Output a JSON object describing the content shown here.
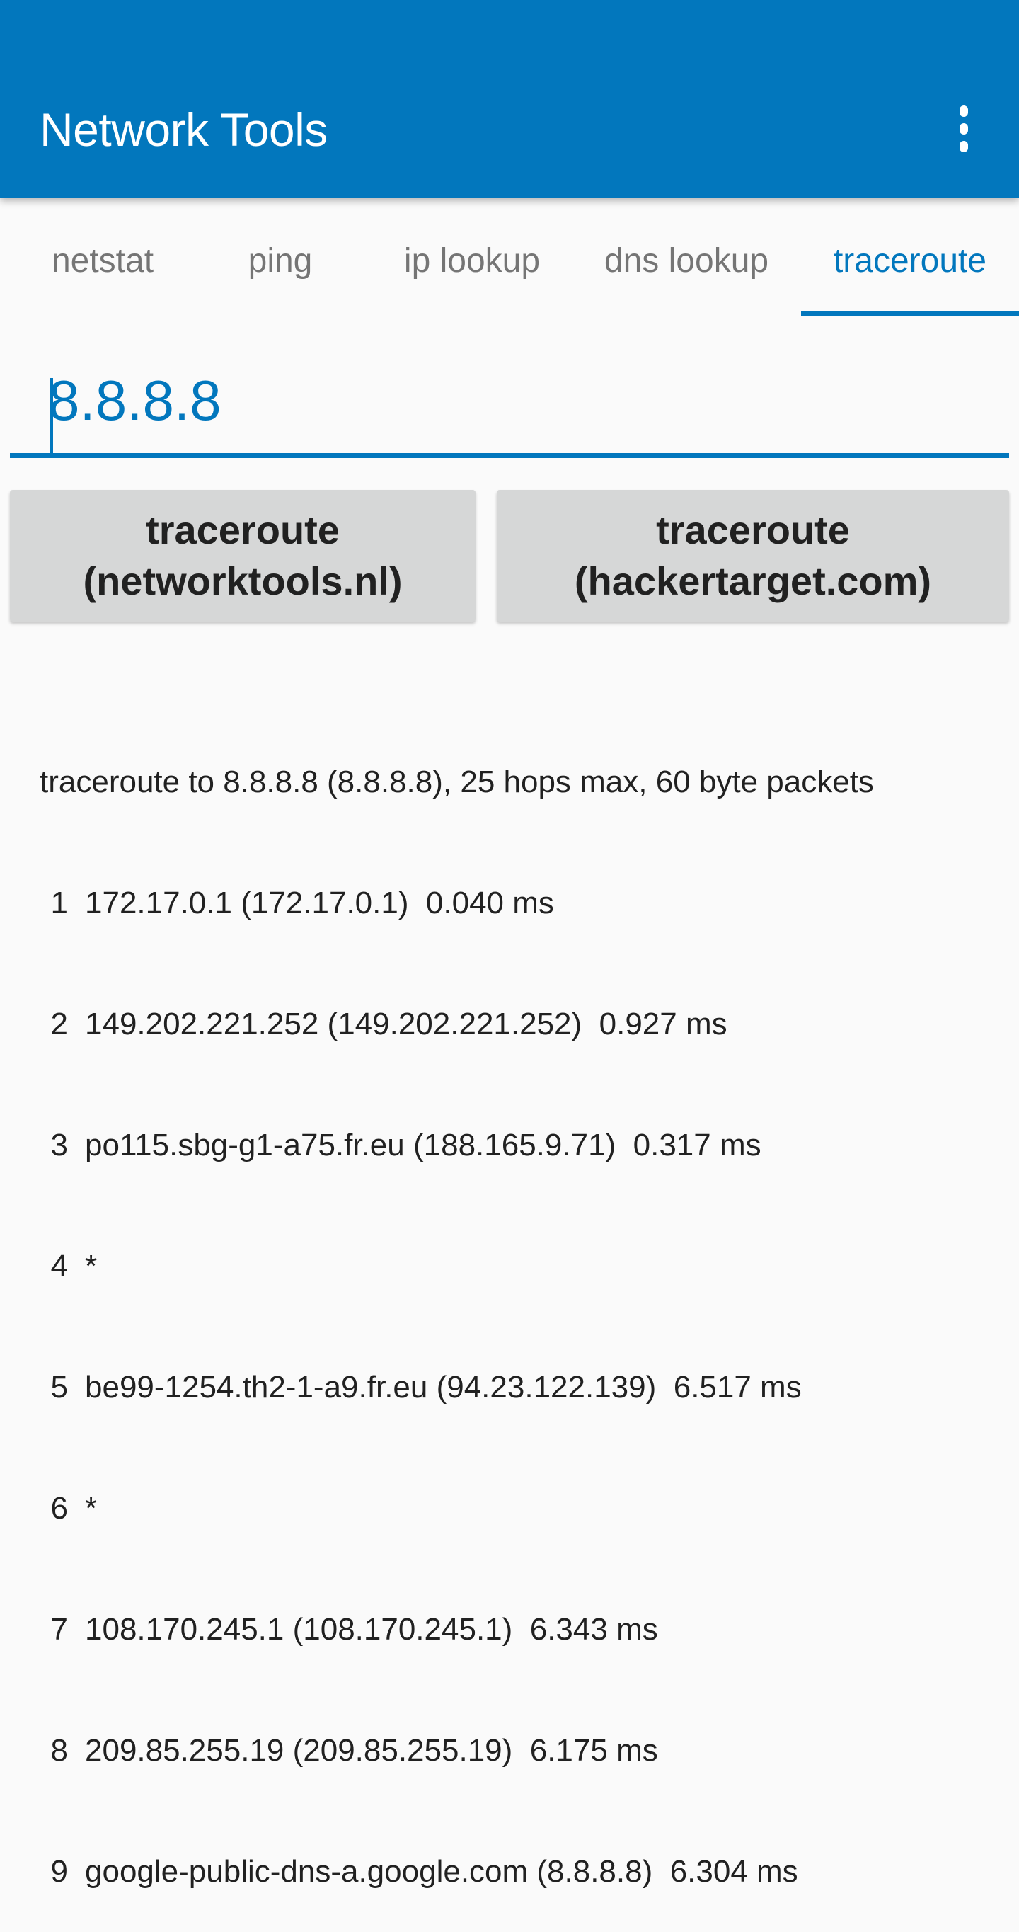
{
  "app_bar": {
    "title": "Network Tools",
    "menu_icon": "more-vert-icon",
    "color": "#0277bd"
  },
  "tabs": [
    {
      "label": "netstat",
      "active": false
    },
    {
      "label": "ping",
      "active": false
    },
    {
      "label": "ip lookup",
      "active": false
    },
    {
      "label": "dns lookup",
      "active": false
    },
    {
      "label": "traceroute",
      "active": true
    }
  ],
  "host_input": {
    "value": "8.8.8.8"
  },
  "buttons": {
    "networktools": {
      "line1": "traceroute",
      "line2": "(networktools.nl)"
    },
    "hackertarget": {
      "line1": "traceroute",
      "line2": "(hackertarget.com)"
    }
  },
  "output": {
    "header": "traceroute to 8.8.8.8 (8.8.8.8), 25 hops max, 60 byte packets",
    "hops": [
      {
        "num": "1",
        "text": "172.17.0.1 (172.17.0.1)  0.040 ms"
      },
      {
        "num": "2",
        "text": "149.202.221.252 (149.202.221.252)  0.927 ms"
      },
      {
        "num": "3",
        "text": "po115.sbg-g1-a75.fr.eu (188.165.9.71)  0.317 ms"
      },
      {
        "num": "4",
        "text": "*"
      },
      {
        "num": "5",
        "text": "be99-1254.th2-1-a9.fr.eu (94.23.122.139)  6.517 ms"
      },
      {
        "num": "6",
        "text": "*"
      },
      {
        "num": "7",
        "text": "108.170.245.1 (108.170.245.1)  6.343 ms"
      },
      {
        "num": "8",
        "text": "209.85.255.19 (209.85.255.19)  6.175 ms"
      },
      {
        "num": "9",
        "text": "google-public-dns-a.google.com (8.8.8.8)  6.304 ms"
      }
    ]
  }
}
